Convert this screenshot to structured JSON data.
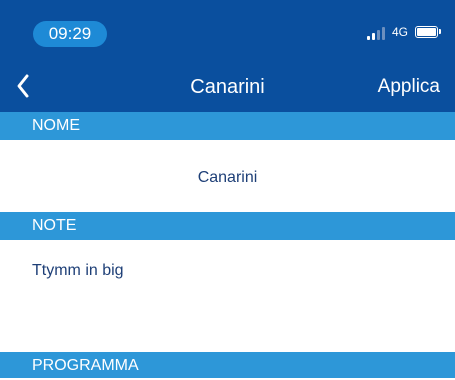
{
  "status_bar": {
    "time": "09:29",
    "network": "4G"
  },
  "nav": {
    "title": "Canarini",
    "apply_label": "Applica"
  },
  "sections": {
    "name": {
      "header": "NOME",
      "value": "Canarini"
    },
    "note": {
      "header": "NOTE",
      "value": "Ttymm in big"
    },
    "program": {
      "header": "PROGRAMMA"
    }
  },
  "colors": {
    "header_bg": "#0a4f9e",
    "section_bg": "#2d97d8",
    "text": "#1e3f77"
  }
}
